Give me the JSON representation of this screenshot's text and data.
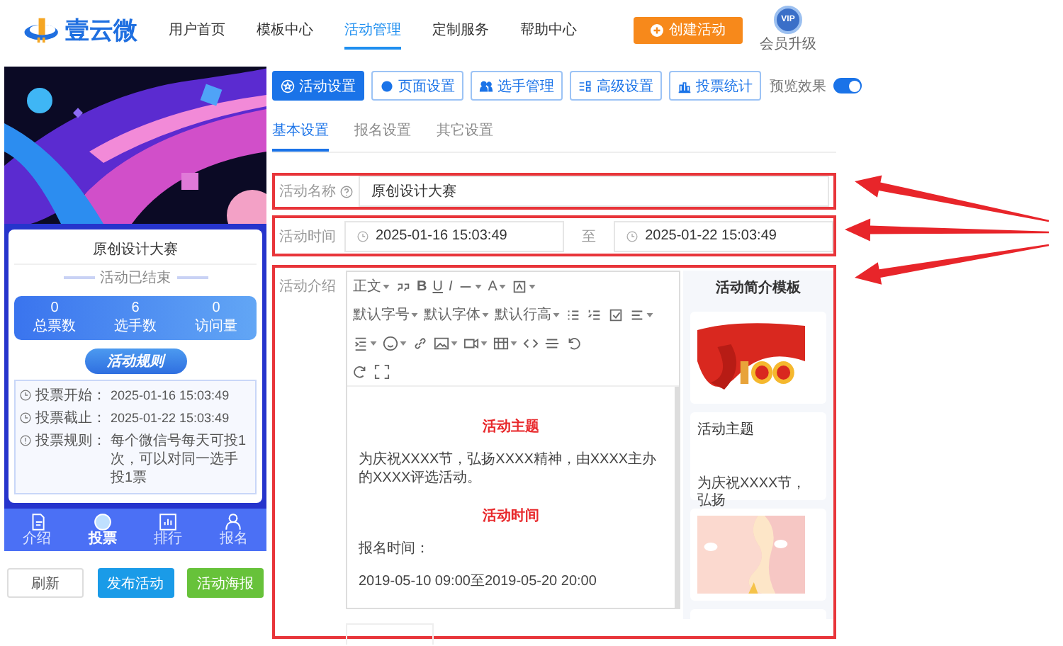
{
  "header": {
    "logo": "壹云微",
    "nav": [
      {
        "label": "用户首页",
        "selected": false
      },
      {
        "label": "模板中心",
        "selected": false
      },
      {
        "label": "活动管理",
        "selected": true
      },
      {
        "label": "定制服务",
        "selected": false
      },
      {
        "label": "帮助中心",
        "selected": false
      }
    ],
    "create_button": "创建活动",
    "vip_badge": "VIP",
    "upgrade": "会员升级"
  },
  "preview": {
    "title": "原创设计大赛",
    "status": "活动已结束",
    "stats": [
      {
        "value": "0",
        "label": "总票数"
      },
      {
        "value": "6",
        "label": "选手数"
      },
      {
        "value": "0",
        "label": "访问量"
      }
    ],
    "rules_title": "活动规则",
    "rules": [
      {
        "kind": "time",
        "label": "投票开始：",
        "value": "2025-01-16 15:03:49"
      },
      {
        "kind": "time",
        "label": "投票截止：",
        "value": "2025-01-22 15:03:49"
      },
      {
        "kind": "info",
        "label": "投票规则：",
        "value": "每个微信号每天可投1次，可以对同一选手投1票"
      }
    ],
    "nav": [
      {
        "label": "介绍",
        "selected": false
      },
      {
        "label": "投票",
        "selected": true
      },
      {
        "label": "排行",
        "selected": false
      },
      {
        "label": "报名",
        "selected": false
      }
    ]
  },
  "actions": [
    {
      "label": "刷新",
      "kind": "default"
    },
    {
      "label": "发布活动",
      "kind": "primary"
    },
    {
      "label": "活动海报",
      "kind": "success"
    }
  ],
  "settings_tabs": [
    {
      "label": "活动设置",
      "selected": true
    },
    {
      "label": "页面设置",
      "selected": false
    },
    {
      "label": "选手管理",
      "selected": false
    },
    {
      "label": "高级设置",
      "selected": false
    },
    {
      "label": "投票统计",
      "selected": false
    }
  ],
  "preview_toggle": {
    "label": "预览效果",
    "on": true
  },
  "subtabs": [
    {
      "label": "基本设置",
      "selected": true
    },
    {
      "label": "报名设置",
      "selected": false
    },
    {
      "label": "其它设置",
      "selected": false
    }
  ],
  "form": {
    "name": {
      "label": "活动名称",
      "value": "原创设计大赛"
    },
    "time": {
      "label": "活动时间",
      "start": "2025-01-16 15:03:49",
      "separator": "至",
      "end": "2025-01-22 15:03:49"
    },
    "intro": {
      "label": "活动介绍",
      "toolbar": [
        {
          "label": "正文",
          "dropdown": true
        },
        {
          "label": "B",
          "dropdown": false
        },
        {
          "label": "U",
          "dropdown": false
        },
        {
          "label": "I",
          "dropdown": false
        },
        {
          "label": "A",
          "dropdown": true
        },
        {
          "label": "默认字号",
          "dropdown": true
        },
        {
          "label": "默认字体",
          "dropdown": true
        },
        {
          "label": "默认行高",
          "dropdown": true
        }
      ],
      "content": [
        {
          "kind": "heading",
          "text": "活动主题"
        },
        {
          "kind": "paragraph",
          "text": "为庆祝XXXX节，弘扬XXXX精神，由XXXX主办的XXXX评选活动。"
        },
        {
          "kind": "heading",
          "text": "活动时间"
        },
        {
          "kind": "paragraph",
          "text": "报名时间："
        },
        {
          "kind": "paragraph",
          "text": "2019-05-10 09:00至2019-05-20 20:00"
        }
      ],
      "templates": {
        "title": "活动简介模板",
        "cards": [
          {
            "kind": "picture"
          },
          {
            "kind": "text",
            "title": "活动主题",
            "text": "为庆祝XXXX节，弘扬"
          },
          {
            "kind": "picture"
          },
          {
            "kind": "blank"
          }
        ]
      }
    }
  }
}
